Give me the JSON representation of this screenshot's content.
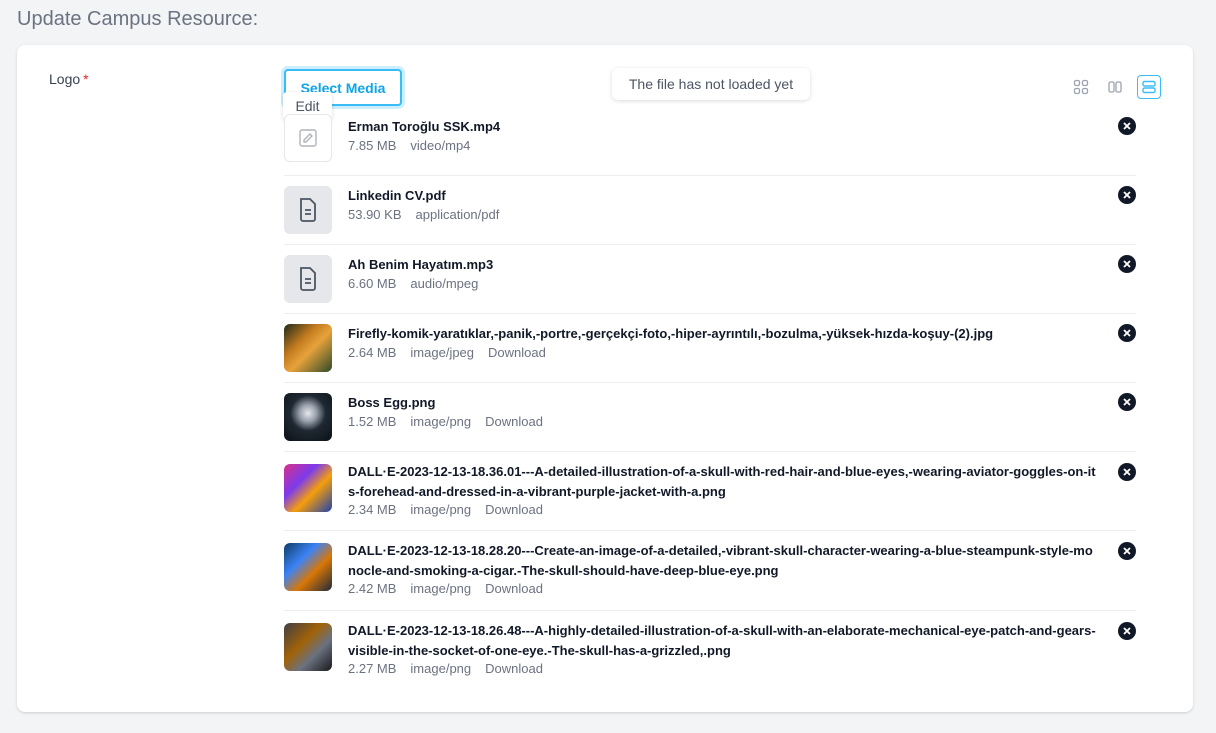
{
  "page": {
    "title": "Update Campus Resource:"
  },
  "field": {
    "label": "Logo",
    "required_mark": "*"
  },
  "media": {
    "select_label": "Select Media",
    "edit_label": "Edit"
  },
  "toast": {
    "message": "The file has not loaded yet"
  },
  "views": [
    "grid-view-icon",
    "columns-view-icon",
    "list-view-icon"
  ],
  "active_view": "list",
  "colors": {
    "accent": "#38bdf8",
    "remove": "#111827",
    "required": "#dc2626"
  },
  "files": [
    {
      "name": "Erman Toroğlu SSK.mp4",
      "size": "7.85 MB",
      "type": "video/mp4",
      "download": "",
      "thumb": "video-icon"
    },
    {
      "name": "Linkedin CV.pdf",
      "size": "53.90 KB",
      "type": "application/pdf",
      "download": "",
      "thumb": "document-icon"
    },
    {
      "name": "Ah Benim Hayatım.mp3",
      "size": "6.60 MB",
      "type": "audio/mpeg",
      "download": "",
      "thumb": "document-icon"
    },
    {
      "name": "Firefly-komik-yaratıklar,-panik,-portre,-gerçekçi-foto,-hiper-ayrıntılı,-bozulma,-yüksek-hızda-koşuy-(2).jpg",
      "size": "2.64 MB",
      "type": "image/jpeg",
      "download": "Download",
      "thumb": "image-thumb"
    },
    {
      "name": "Boss Egg.png",
      "size": "1.52 MB",
      "type": "image/png",
      "download": "Download",
      "thumb": "image-thumb"
    },
    {
      "name": "DALL·E-2023-12-13-18.36.01---A-detailed-illustration-of-a-skull-with-red-hair-and-blue-eyes,-wearing-aviator-goggles-on-its-forehead-and-dressed-in-a-vibrant-purple-jacket-with-a.png",
      "size": "2.34 MB",
      "type": "image/png",
      "download": "Download",
      "thumb": "image-thumb"
    },
    {
      "name": "DALL·E-2023-12-13-18.28.20---Create-an-image-of-a-detailed,-vibrant-skull-character-wearing-a-blue-steampunk-style-monocle-and-smoking-a-cigar.-The-skull-should-have-deep-blue-eye.png",
      "size": "2.42 MB",
      "type": "image/png",
      "download": "Download",
      "thumb": "image-thumb"
    },
    {
      "name": "DALL·E-2023-12-13-18.26.48---A-highly-detailed-illustration-of-a-skull-with-an-elaborate-mechanical-eye-patch-and-gears-visible-in-the-socket-of-one-eye.-The-skull-has-a-grizzled,.png",
      "size": "2.27 MB",
      "type": "image/png",
      "download": "Download",
      "thumb": "image-thumb"
    }
  ]
}
